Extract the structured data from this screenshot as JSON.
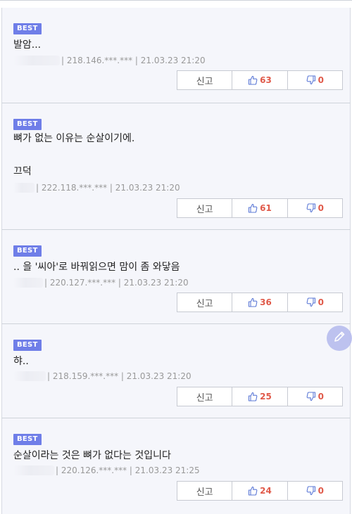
{
  "best_label": "BEST",
  "report_label": "신고",
  "colors": {
    "badge": "#6f7ee8",
    "count": "#e05a4a",
    "icon": "#5b78d6",
    "fab": "#b4b9ee"
  },
  "icons": {
    "up": "thumbs-up-icon",
    "down": "thumbs-down-icon",
    "fab": "pencil-icon"
  },
  "comments": [
    {
      "lines": [
        "발암..."
      ],
      "meta": "| 218.146.***.*** | 21.03.23 21:20",
      "up": "63",
      "down": "0"
    },
    {
      "lines": [
        "뼈가 없는 이유는 순살이기에.",
        "",
        "끄덕"
      ],
      "meta": "| 222.118.***.*** | 21.03.23 21:20",
      "up": "61",
      "down": "0"
    },
    {
      "lines": [
        ".. 을 '씨아'로 바꿔읽으면 맘이 좀 와닿음"
      ],
      "meta": "| 220.127.***.*** | 21.03.23 21:20",
      "up": "36",
      "down": "0"
    },
    {
      "lines": [
        "햐.."
      ],
      "meta": "| 218.159.***.*** | 21.03.23 21:20",
      "up": "25",
      "down": "0"
    },
    {
      "lines": [
        "순살이라는 것은 뼈가 없다는 것입니다"
      ],
      "meta": "| 220.126.***.*** | 21.03.23 21:25",
      "up": "24",
      "down": "0"
    }
  ]
}
